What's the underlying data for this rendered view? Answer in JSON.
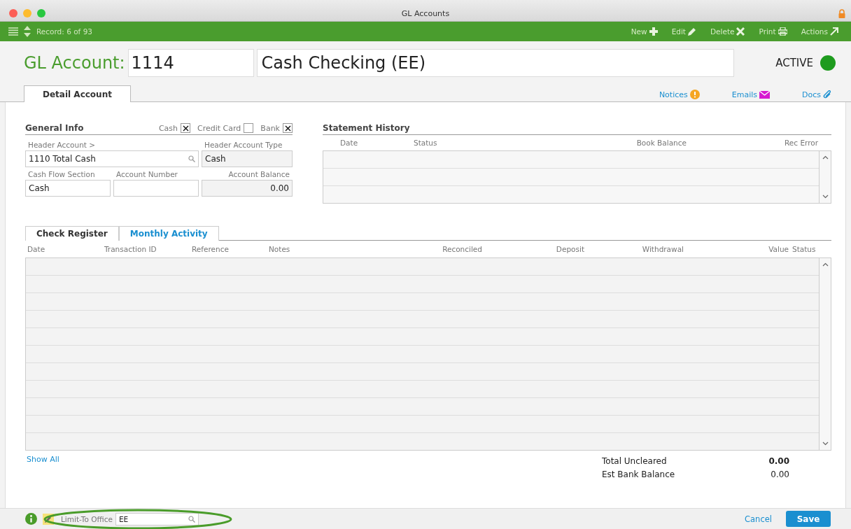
{
  "window": {
    "title": "GL Accounts"
  },
  "toolbar": {
    "record": "Record: 6 of 93",
    "actions": [
      {
        "label": "New",
        "kind": "plus"
      },
      {
        "label": "Edit",
        "kind": "pencil"
      },
      {
        "label": "Delete",
        "kind": "cross"
      },
      {
        "label": "Print",
        "kind": "printer"
      },
      {
        "label": "Actions",
        "kind": "arrow"
      }
    ]
  },
  "header": {
    "label": "GL Account:",
    "number": "1114",
    "name": "Cash Checking (EE)",
    "status": "ACTIVE",
    "active": true
  },
  "tabs": [
    {
      "label": "Detail Account",
      "selected": true
    }
  ],
  "links": [
    {
      "label": "Notices",
      "kind": "notice"
    },
    {
      "label": "Emails",
      "kind": "mail"
    },
    {
      "label": "Docs",
      "kind": "clip"
    }
  ],
  "general_info": {
    "title": "General Info",
    "checkboxes": [
      {
        "label": "Cash",
        "checked": true
      },
      {
        "label": "Credit Card",
        "checked": false
      },
      {
        "label": "Bank",
        "checked": true
      }
    ],
    "header_account": {
      "label": "Header Account >",
      "value": "1110 Total Cash"
    },
    "header_account_type": {
      "label": "Header Account Type",
      "value": "Cash"
    },
    "cash_flow_section": {
      "label": "Cash Flow Section",
      "value": "Cash"
    },
    "account_number": {
      "label": "Account Number"
    },
    "account_balance": {
      "label": "Account Balance",
      "value": "0.00"
    }
  },
  "statement_history": {
    "title": "Statement History",
    "columns": [
      "Date",
      "Status",
      "Book Balance",
      "Rec Error"
    ]
  },
  "register_tabs": [
    {
      "label": "Check Register",
      "selected": true
    },
    {
      "label": "Monthly Activity",
      "selected": false
    }
  ],
  "register": {
    "columns": [
      "Date",
      "Transaction ID",
      "Reference",
      "Notes",
      "Reconciled",
      "Deposit",
      "Withdrawal",
      "Value",
      "Status"
    ]
  },
  "show_all": "Show All",
  "totals": [
    {
      "label": "Total Uncleared",
      "value": "0.00",
      "bold": true
    },
    {
      "label": "Est Bank Balance",
      "value": "0.00",
      "bold": false
    }
  ],
  "footer": {
    "limit_label": "Limit-To Office",
    "limit_value": "EE",
    "cancel": "Cancel",
    "save": "Save"
  }
}
